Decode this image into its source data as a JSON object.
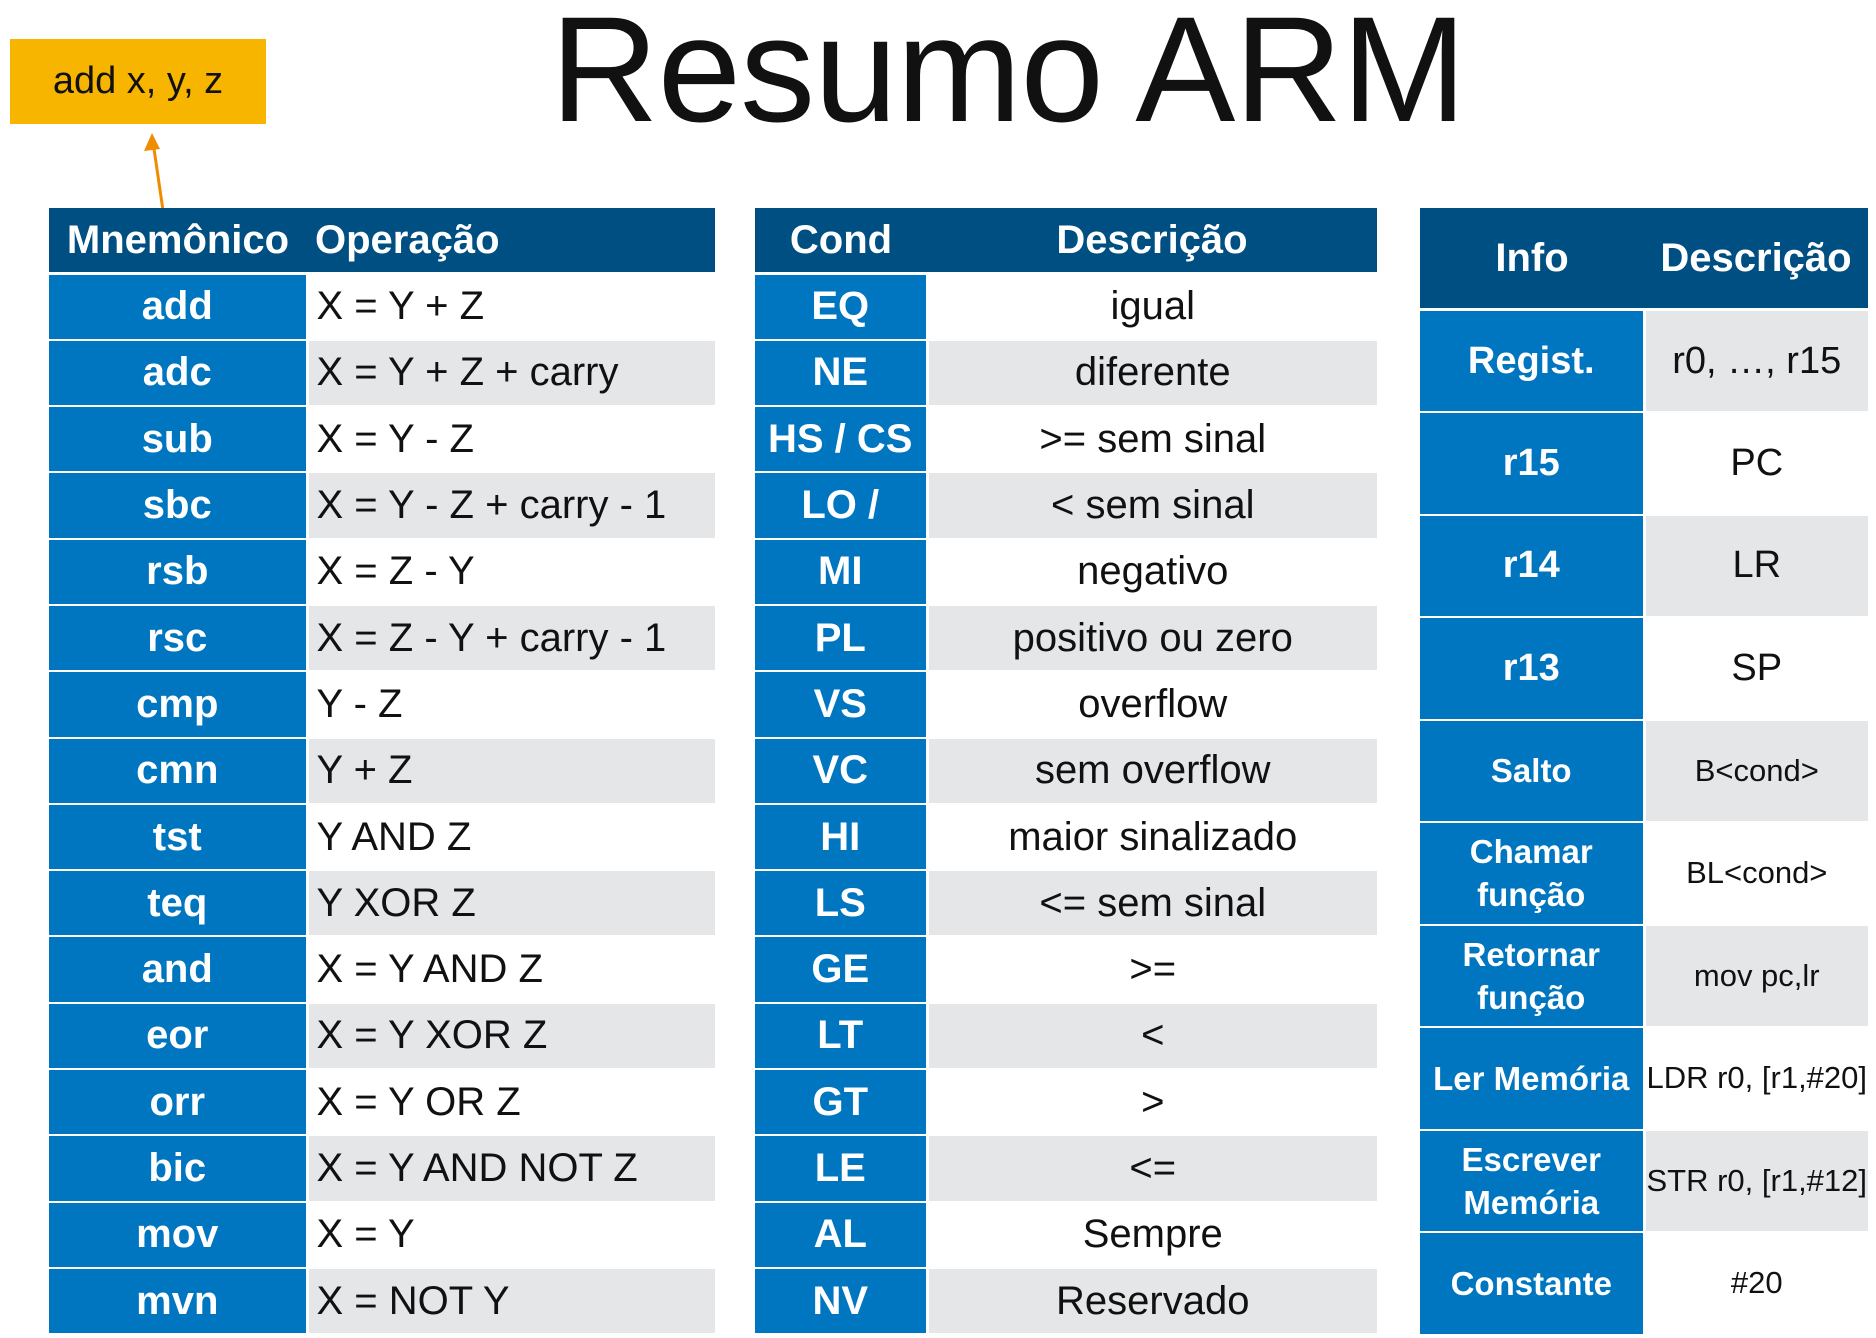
{
  "title": "Resumo ARM",
  "callout": "add x, y, z",
  "colors": {
    "header_bg": "#004f82",
    "key_bg": "#0075c0",
    "row_alt": "#e5e6e8",
    "callout_bg": "#f7b500",
    "arrow": "#f08c00"
  },
  "instructions": {
    "headers": [
      "Mnemônico",
      "Operação"
    ],
    "rows": [
      {
        "key": "add",
        "value": "X = Y + Z"
      },
      {
        "key": "adc",
        "value": "X = Y + Z + carry"
      },
      {
        "key": "sub",
        "value": "X = Y - Z"
      },
      {
        "key": "sbc",
        "value": "X = Y - Z + carry - 1"
      },
      {
        "key": "rsb",
        "value": "X = Z - Y"
      },
      {
        "key": "rsc",
        "value": "X = Z - Y + carry - 1"
      },
      {
        "key": "cmp",
        "value": "Y - Z"
      },
      {
        "key": "cmn",
        "value": "Y + Z"
      },
      {
        "key": "tst",
        "value": "Y AND Z"
      },
      {
        "key": "teq",
        "value": "Y XOR Z"
      },
      {
        "key": "and",
        "value": "X = Y AND Z"
      },
      {
        "key": "eor",
        "value": "X = Y XOR Z"
      },
      {
        "key": "orr",
        "value": "X = Y OR Z"
      },
      {
        "key": "bic",
        "value": "X = Y AND NOT Z"
      },
      {
        "key": "mov",
        "value": "X = Y"
      },
      {
        "key": "mvn",
        "value": "X = NOT Y"
      }
    ]
  },
  "conditions": {
    "headers": [
      "Cond",
      "Descrição"
    ],
    "rows": [
      {
        "key": "EQ",
        "value": "igual"
      },
      {
        "key": "NE",
        "value": "diferente"
      },
      {
        "key": "HS / CS",
        "value": ">= sem sinal"
      },
      {
        "key": "LO /",
        "value": "< sem sinal"
      },
      {
        "key": "MI",
        "value": "negativo"
      },
      {
        "key": "PL",
        "value": "positivo ou zero"
      },
      {
        "key": "VS",
        "value": "overflow"
      },
      {
        "key": "VC",
        "value": "sem overflow"
      },
      {
        "key": "HI",
        "value": "maior sinalizado"
      },
      {
        "key": "LS",
        "value": "<= sem sinal"
      },
      {
        "key": "GE",
        "value": ">="
      },
      {
        "key": "LT",
        "value": "<"
      },
      {
        "key": "GT",
        "value": ">"
      },
      {
        "key": "LE",
        "value": "<="
      },
      {
        "key": "AL",
        "value": "Sempre"
      },
      {
        "key": "NV",
        "value": "Reservado"
      }
    ]
  },
  "info": {
    "headers": [
      "Info",
      "Descrição"
    ],
    "rows": [
      {
        "key": "Regist.",
        "value": "r0, …, r15"
      },
      {
        "key": "r15",
        "value": "PC"
      },
      {
        "key": "r14",
        "value": "LR"
      },
      {
        "key": "r13",
        "value": "SP"
      },
      {
        "key": "Salto",
        "value": "B<cond>"
      },
      {
        "key": "Chamar função",
        "value": "BL<cond>"
      },
      {
        "key": "Retornar função",
        "value": "mov pc,lr"
      },
      {
        "key": "Ler Memória",
        "value": "LDR r0, [r1,#20]"
      },
      {
        "key": "Escrever Memória",
        "value": "STR r0, [r1,#12]"
      },
      {
        "key": "Constante",
        "value": "#20"
      }
    ]
  }
}
